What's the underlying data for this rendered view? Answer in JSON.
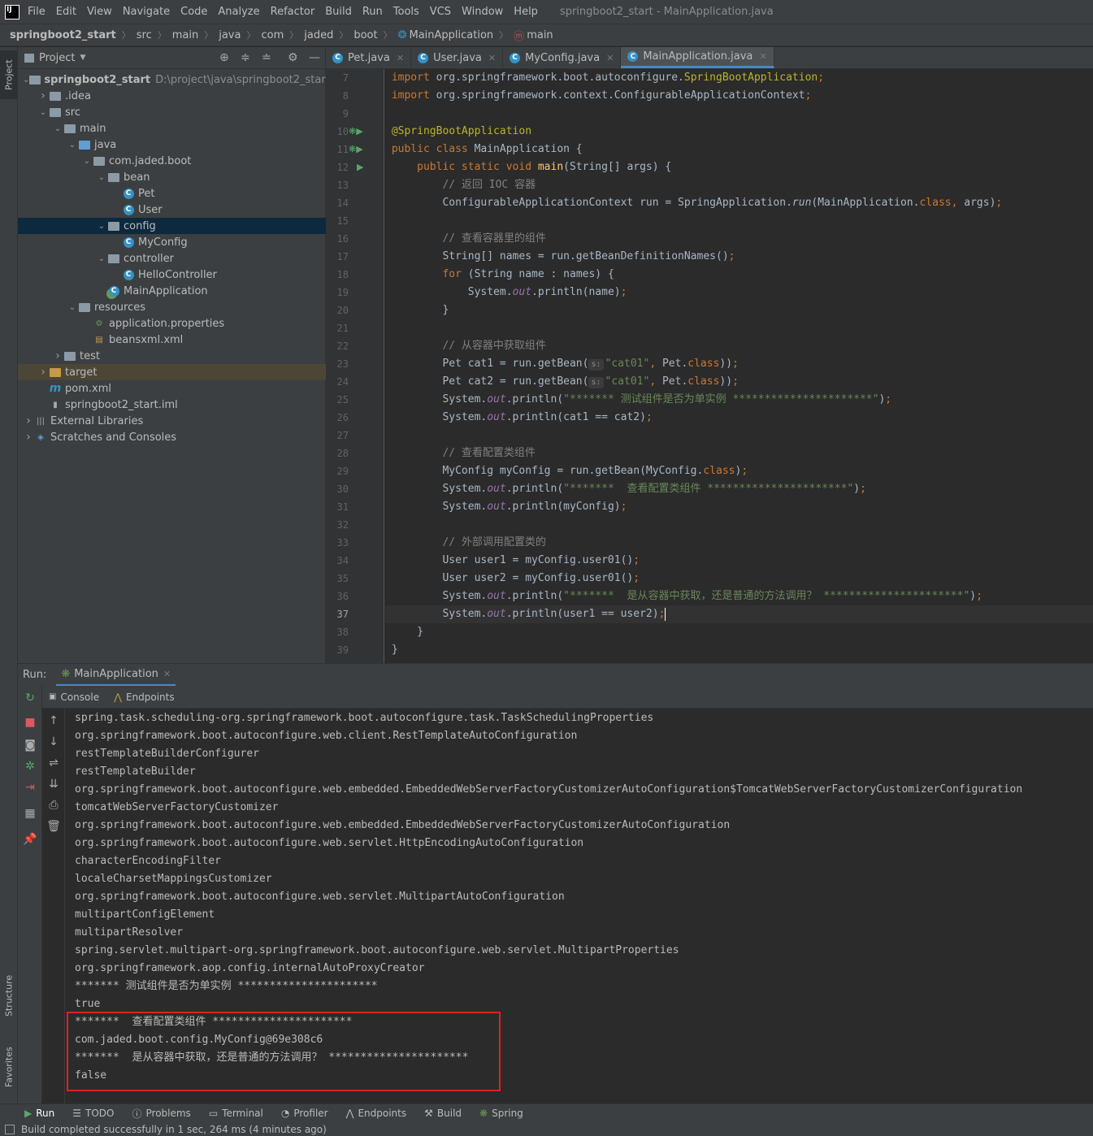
{
  "menu": {
    "items": [
      "File",
      "Edit",
      "View",
      "Navigate",
      "Code",
      "Analyze",
      "Refactor",
      "Build",
      "Run",
      "Tools",
      "VCS",
      "Window",
      "Help"
    ],
    "window_title": "springboot2_start - MainApplication.java"
  },
  "breadcrumb": [
    "springboot2_start",
    "src",
    "main",
    "java",
    "com",
    "jaded",
    "boot",
    "MainApplication",
    "main"
  ],
  "left_stripe": {
    "project": "Project",
    "structure": "Structure",
    "favorites": "Favorites"
  },
  "project": {
    "title": "Project",
    "tree": [
      {
        "label": "springboot2_start",
        "hint": "D:\\project\\java\\springboot2_start",
        "depth": 0,
        "arrow": "open",
        "icon": "folder",
        "bold": true
      },
      {
        "label": ".idea",
        "depth": 1,
        "arrow": "closed",
        "icon": "folder"
      },
      {
        "label": "src",
        "depth": 1,
        "arrow": "open",
        "icon": "folder"
      },
      {
        "label": "main",
        "depth": 2,
        "arrow": "open",
        "icon": "folder"
      },
      {
        "label": "java",
        "depth": 3,
        "arrow": "open",
        "icon": "folder-blue"
      },
      {
        "label": "com.jaded.boot",
        "depth": 4,
        "arrow": "open",
        "icon": "folder"
      },
      {
        "label": "bean",
        "depth": 5,
        "arrow": "open",
        "icon": "folder"
      },
      {
        "label": "Pet",
        "depth": 6,
        "arrow": "",
        "icon": "class"
      },
      {
        "label": "User",
        "depth": 6,
        "arrow": "",
        "icon": "class"
      },
      {
        "label": "config",
        "depth": 5,
        "arrow": "open",
        "icon": "folder",
        "selected": true
      },
      {
        "label": "MyConfig",
        "depth": 6,
        "arrow": "",
        "icon": "class"
      },
      {
        "label": "controller",
        "depth": 5,
        "arrow": "open",
        "icon": "folder"
      },
      {
        "label": "HelloController",
        "depth": 6,
        "arrow": "",
        "icon": "class"
      },
      {
        "label": "MainApplication",
        "depth": 5,
        "arrow": "",
        "icon": "spring-class"
      },
      {
        "label": "resources",
        "depth": 3,
        "arrow": "open",
        "icon": "folder"
      },
      {
        "label": "application.properties",
        "depth": 4,
        "arrow": "",
        "icon": "properties"
      },
      {
        "label": "beansxml.xml",
        "depth": 4,
        "arrow": "",
        "icon": "xml"
      },
      {
        "label": "test",
        "depth": 2,
        "arrow": "closed",
        "icon": "folder"
      },
      {
        "label": "target",
        "depth": 1,
        "arrow": "closed",
        "icon": "folder-orange",
        "excluded": true
      },
      {
        "label": "pom.xml",
        "depth": 1,
        "arrow": "",
        "icon": "maven"
      },
      {
        "label": "springboot2_start.iml",
        "depth": 1,
        "arrow": "",
        "icon": "iml"
      },
      {
        "label": "External Libraries",
        "depth": 0,
        "arrow": "closed",
        "icon": "libs"
      },
      {
        "label": "Scratches and Consoles",
        "depth": 0,
        "arrow": "closed",
        "icon": "scratch"
      }
    ]
  },
  "editor": {
    "tabs": [
      {
        "label": "Pet.java",
        "active": false
      },
      {
        "label": "User.java",
        "active": false
      },
      {
        "label": "MyConfig.java",
        "active": false
      },
      {
        "label": "MainApplication.java",
        "active": true
      }
    ],
    "lines": [
      {
        "n": "7",
        "tokens": [
          [
            "kw",
            "import "
          ],
          [
            "",
            "org.springframework.boot.autoconfigure."
          ],
          [
            "an",
            "SpringBootApplication"
          ],
          [
            "kw",
            ";"
          ]
        ]
      },
      {
        "n": "8",
        "tokens": [
          [
            "kw",
            "import "
          ],
          [
            "",
            "org.springframework.context.ConfigurableApplicationContext"
          ],
          [
            "kw",
            ";"
          ]
        ]
      },
      {
        "n": "9",
        "tokens": []
      },
      {
        "n": "10",
        "tokens": [
          [
            "an",
            "@SpringBootApplication"
          ]
        ]
      },
      {
        "n": "11",
        "tokens": [
          [
            "kw",
            "public class "
          ],
          [
            "",
            "MainApplication {"
          ]
        ]
      },
      {
        "n": "12",
        "tokens": [
          [
            "",
            "    "
          ],
          [
            "kw",
            "public static void "
          ],
          [
            "fn",
            "main"
          ],
          [
            "",
            "(String[] args) {"
          ]
        ]
      },
      {
        "n": "13",
        "tokens": [
          [
            "",
            "        "
          ],
          [
            "cm",
            "// 返回 IOC 容器"
          ]
        ]
      },
      {
        "n": "14",
        "tokens": [
          [
            "",
            "        ConfigurableApplicationContext run = SpringApplication."
          ],
          [
            "it",
            "run"
          ],
          [
            "",
            "(MainApplication."
          ],
          [
            "kw",
            "class, "
          ],
          [
            "",
            "args)"
          ],
          [
            "kw",
            ";"
          ]
        ]
      },
      {
        "n": "15",
        "tokens": []
      },
      {
        "n": "16",
        "tokens": [
          [
            "",
            "        "
          ],
          [
            "cm",
            "// 查看容器里的组件"
          ]
        ]
      },
      {
        "n": "17",
        "tokens": [
          [
            "",
            "        String[] names = run.getBeanDefinitionNames()"
          ],
          [
            "kw",
            ";"
          ]
        ]
      },
      {
        "n": "18",
        "tokens": [
          [
            "",
            "        "
          ],
          [
            "kw",
            "for "
          ],
          [
            "",
            "(String name : names) {"
          ]
        ]
      },
      {
        "n": "19",
        "tokens": [
          [
            "",
            "            System."
          ],
          [
            "st",
            "out"
          ],
          [
            "",
            "."
          ],
          [
            "",
            "println(name)"
          ],
          [
            "kw",
            ";"
          ]
        ]
      },
      {
        "n": "20",
        "tokens": [
          [
            "",
            "        }"
          ]
        ]
      },
      {
        "n": "21",
        "tokens": []
      },
      {
        "n": "22",
        "tokens": [
          [
            "",
            "        "
          ],
          [
            "cm",
            "// 从容器中获取组件"
          ]
        ]
      },
      {
        "n": "23",
        "tokens": [
          [
            "",
            "        Pet cat1 = run.getBean("
          ],
          [
            "pill",
            "s:"
          ],
          [
            "str",
            "\"cat01\""
          ],
          [
            "kw",
            ", "
          ],
          [
            "",
            "Pet."
          ],
          [
            "kw",
            "class"
          ],
          [
            "",
            "))"
          ],
          [
            "kw",
            ";"
          ]
        ]
      },
      {
        "n": "24",
        "tokens": [
          [
            "",
            "        Pet cat2 = run.getBean("
          ],
          [
            "pill",
            "s:"
          ],
          [
            "str",
            "\"cat01\""
          ],
          [
            "kw",
            ", "
          ],
          [
            "",
            "Pet."
          ],
          [
            "kw",
            "class"
          ],
          [
            "",
            "))"
          ],
          [
            "kw",
            ";"
          ]
        ]
      },
      {
        "n": "25",
        "tokens": [
          [
            "",
            "        System."
          ],
          [
            "st",
            "out"
          ],
          [
            "",
            ".println("
          ],
          [
            "str",
            "\"******* 测试组件是否为单实例 **********************\""
          ],
          [
            "",
            ")"
          ],
          [
            "kw",
            ";"
          ]
        ]
      },
      {
        "n": "26",
        "tokens": [
          [
            "",
            "        System."
          ],
          [
            "st",
            "out"
          ],
          [
            "",
            ".println(cat1 == cat2)"
          ],
          [
            "kw",
            ";"
          ]
        ]
      },
      {
        "n": "27",
        "tokens": []
      },
      {
        "n": "28",
        "tokens": [
          [
            "",
            "        "
          ],
          [
            "cm",
            "// 查看配置类组件"
          ]
        ]
      },
      {
        "n": "29",
        "tokens": [
          [
            "",
            "        MyConfig myConfig = run.getBean(MyConfig."
          ],
          [
            "kw",
            "class"
          ],
          [
            "",
            ")"
          ],
          [
            "kw",
            ";"
          ]
        ]
      },
      {
        "n": "30",
        "tokens": [
          [
            "",
            "        System."
          ],
          [
            "st",
            "out"
          ],
          [
            "",
            ".println("
          ],
          [
            "str",
            "\"*******  查看配置类组件 **********************\""
          ],
          [
            "",
            ")"
          ],
          [
            "kw",
            ";"
          ]
        ]
      },
      {
        "n": "31",
        "tokens": [
          [
            "",
            "        System."
          ],
          [
            "st",
            "out"
          ],
          [
            "",
            ".println(myConfig)"
          ],
          [
            "kw",
            ";"
          ]
        ]
      },
      {
        "n": "32",
        "tokens": []
      },
      {
        "n": "33",
        "tokens": [
          [
            "",
            "        "
          ],
          [
            "cm",
            "// 外部调用配置类的"
          ]
        ]
      },
      {
        "n": "34",
        "tokens": [
          [
            "",
            "        User user1 = myConfig.user01()"
          ],
          [
            "kw",
            ";"
          ]
        ]
      },
      {
        "n": "35",
        "tokens": [
          [
            "",
            "        User user2 = myConfig.user01()"
          ],
          [
            "kw",
            ";"
          ]
        ]
      },
      {
        "n": "36",
        "tokens": [
          [
            "",
            "        System."
          ],
          [
            "st",
            "out"
          ],
          [
            "",
            ".println("
          ],
          [
            "str",
            "\"*******  是从容器中获取，还是普通的方法调用？ **********************\""
          ],
          [
            "",
            ")"
          ],
          [
            "kw",
            ";"
          ]
        ]
      },
      {
        "n": "37",
        "tokens": [
          [
            "",
            "        System."
          ],
          [
            "st",
            "out"
          ],
          [
            "",
            ".println(user1 == user2)"
          ],
          [
            "kw",
            ";"
          ]
        ],
        "current": true
      },
      {
        "n": "38",
        "tokens": [
          [
            "",
            "    }"
          ]
        ]
      },
      {
        "n": "39",
        "tokens": [
          [
            "",
            "}"
          ]
        ]
      }
    ]
  },
  "run": {
    "label": "Run:",
    "config": "MainApplication",
    "subtabs": [
      "Console",
      "Endpoints"
    ],
    "output": [
      "spring.task.scheduling-org.springframework.boot.autoconfigure.task.TaskSchedulingProperties",
      "org.springframework.boot.autoconfigure.web.client.RestTemplateAutoConfiguration",
      "restTemplateBuilderConfigurer",
      "restTemplateBuilder",
      "org.springframework.boot.autoconfigure.web.embedded.EmbeddedWebServerFactoryCustomizerAutoConfiguration$TomcatWebServerFactoryCustomizerConfiguration",
      "tomcatWebServerFactoryCustomizer",
      "org.springframework.boot.autoconfigure.web.embedded.EmbeddedWebServerFactoryCustomizerAutoConfiguration",
      "org.springframework.boot.autoconfigure.web.servlet.HttpEncodingAutoConfiguration",
      "characterEncodingFilter",
      "localeCharsetMappingsCustomizer",
      "org.springframework.boot.autoconfigure.web.servlet.MultipartAutoConfiguration",
      "multipartConfigElement",
      "multipartResolver",
      "spring.servlet.multipart-org.springframework.boot.autoconfigure.web.servlet.MultipartProperties",
      "org.springframework.aop.config.internalAutoProxyCreator",
      "******* 测试组件是否为单实例 **********************",
      "true",
      "*******  查看配置类组件 **********************",
      "com.jaded.boot.config.MyConfig@69e308c6",
      "*******  是从容器中获取，还是普通的方法调用？ **********************",
      "false"
    ]
  },
  "bottom_tabs": [
    {
      "label": "Run",
      "icon": "run-icon"
    },
    {
      "label": "TODO",
      "icon": "todo-icon"
    },
    {
      "label": "Problems",
      "icon": "problems-icon"
    },
    {
      "label": "Terminal",
      "icon": "terminal-icon"
    },
    {
      "label": "Profiler",
      "icon": "profiler-icon"
    },
    {
      "label": "Endpoints",
      "icon": "endpoints-icon"
    },
    {
      "label": "Build",
      "icon": "build-icon"
    },
    {
      "label": "Spring",
      "icon": "spring-icon"
    }
  ],
  "status": "Build completed successfully in 1 sec, 264 ms (4 minutes ago)",
  "colors": {
    "keyword": "#cc7832",
    "annotation": "#bbb529",
    "string": "#6a8759",
    "comment": "#808080",
    "static_field": "#9876aa",
    "method": "#ffc66d",
    "highlight_box": "#e02020"
  }
}
